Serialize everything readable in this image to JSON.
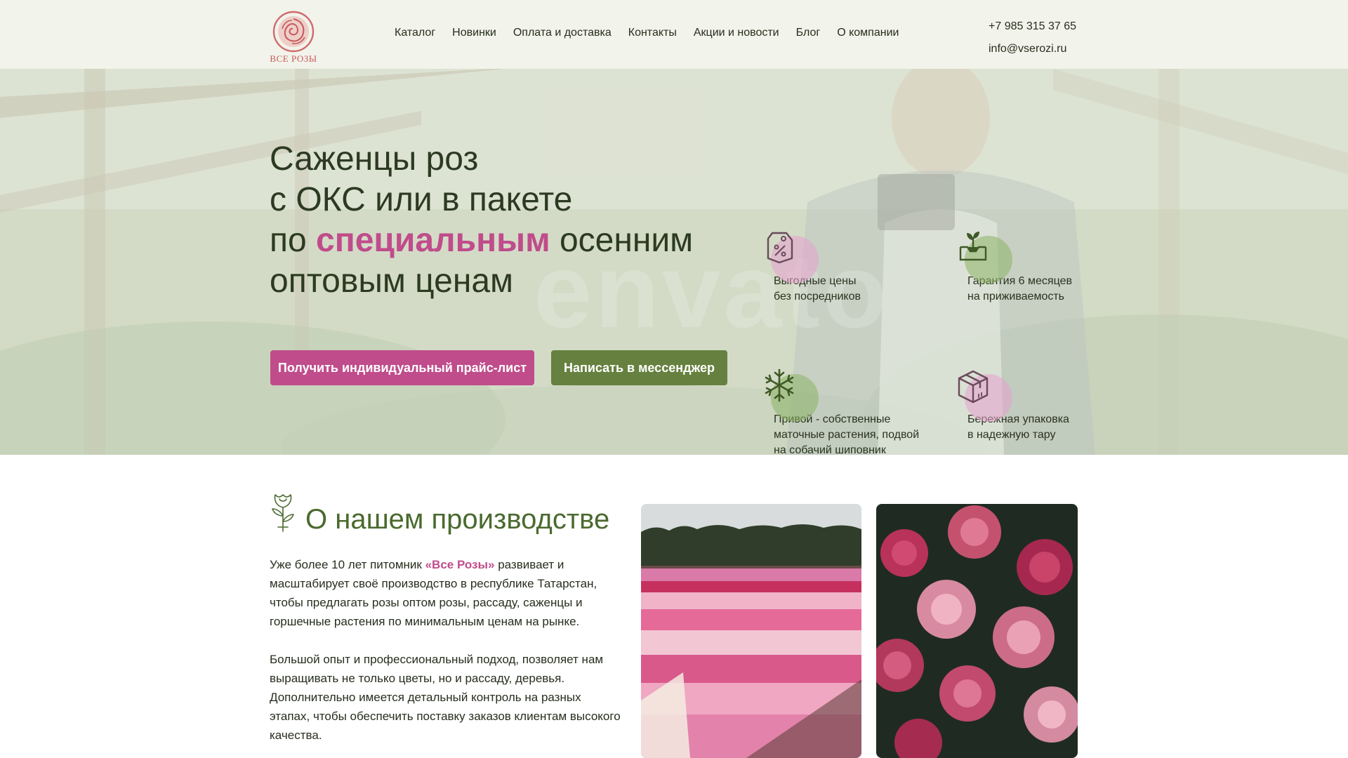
{
  "header": {
    "logo_text": "ВСЕ РОЗЫ",
    "nav": [
      {
        "label": "Каталог"
      },
      {
        "label": "Новинки"
      },
      {
        "label": "Оплата и доставка"
      },
      {
        "label": "Контакты"
      },
      {
        "label": "Акции и новости"
      },
      {
        "label": "Блог"
      },
      {
        "label": "О компании"
      }
    ],
    "phone": "+7 985 315 37 65",
    "email": "info@vserozi.ru"
  },
  "hero": {
    "title_line1": "Саженцы роз",
    "title_line2": "с ОКС или в пакете",
    "title_line3_pre": "по ",
    "title_line3_accent": "специальным",
    "title_line3_post": " осенним",
    "title_line4": "оптовым ценам",
    "watermark": "envato",
    "button_primary": "Получить индивидуальный прайс-лист",
    "button_secondary": "Написать в мессенджер",
    "features": [
      {
        "icon": "price-tag-percent-icon",
        "line1": "Выгодные цены",
        "line2": "без посредников",
        "line3": ""
      },
      {
        "icon": "seedling-box-icon",
        "line1": "Гарантия 6 месяцев",
        "line2": "на приживаемость",
        "line3": ""
      },
      {
        "icon": "snowflake-icon",
        "line1": "Привой - собственные",
        "line2": "маточные растения, подвой",
        "line3": "на собачий шиповник"
      },
      {
        "icon": "package-box-icon",
        "line1": "Бережная упаковка",
        "line2": "в надежную тару",
        "line3": ""
      }
    ]
  },
  "about": {
    "title": "О нашем производстве",
    "p1_pre": "Уже более 10 лет питомник ",
    "p1_brand": "«Все Розы»",
    "p1_post": " развивает и масштабирует своё производство в республике Татарстан, чтобы предлагать розы оптом розы, рассаду, саженцы и горшечные растения по минимальным ценам на рынке.",
    "p2": "Большой опыт и профессиональный подход, позволяет нам выращивать не только цветы, но и рассаду, деревья. Дополнительно имеется детальный контроль на разных этапах, чтобы обеспечить поставку заказов клиентам высокого качества."
  },
  "colors": {
    "accent_pink": "#c04c8b",
    "accent_green": "#66813f",
    "header_bg": "#f2f3ea",
    "title_green": "#4a6a2e"
  }
}
